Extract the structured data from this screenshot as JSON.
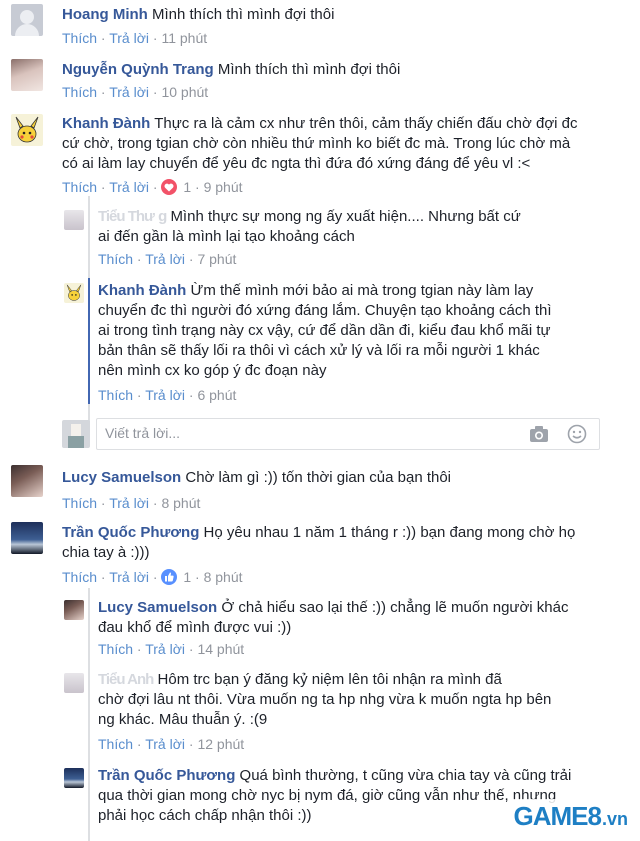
{
  "actions": {
    "like": "Thích",
    "reply": "Trả lời",
    "sep": "·"
  },
  "comments": [
    {
      "name": "Hoang Minh",
      "text": "Mình thích thì mình đợi thôi",
      "time": "11 phút"
    },
    {
      "name": "Nguyễn Quỳnh Trang",
      "text": "Mình thích thì mình đợi thôi",
      "time": "10 phút"
    },
    {
      "name": "Khanh Đành",
      "lines": [
        "Thực ra là cảm cx như trên thôi, cảm thấy chiến đấu chờ đợi đc",
        "cứ chờ, trong tgian chờ còn nhiều thứ mình ko biết đc mà. Trong lúc chờ mà",
        "có ai làm lay chuyển để yêu đc ngta thì đứa đó xứng đáng để yêu vl :<"
      ],
      "reactions": "1",
      "time": "9 phút"
    },
    {
      "name": "Tiểu Thư",
      "name_tail": "g",
      "lines": [
        "Mình thực sự mong ng ấy xuất hiện.... Nhưng bất cứ",
        "ai đến gần là mình lại tạo khoảng cách"
      ],
      "time": "7 phút"
    },
    {
      "name": "Khanh Đành",
      "lines": [
        "Ừm thế mình mới bảo ai mà trong tgian này làm lay",
        "chuyển đc thì người đó xứng đáng lắm. Chuyện tạo khoảng cách thì",
        "ai trong tình trạng này cx vậy, cứ để dần dần đi, kiểu đau khổ mãi tự",
        "bản thân sẽ thấy lối ra thôi vì cách xử lý và lối ra mỗi người 1 khác",
        "nên mình cx ko góp ý đc đoạn này"
      ],
      "time": "6 phút"
    },
    {
      "name": "Lucy Samuelson",
      "text": "Chờ làm gì :)) tốn thời gian của bạn thôi",
      "time": "8 phút"
    },
    {
      "name": "Trần Quốc Phương",
      "lines": [
        "Họ yêu nhau 1 năm 1 tháng r :)) bạn đang mong chờ họ",
        "chia tay à :)))"
      ],
      "reactions": "1",
      "time": "8 phút"
    },
    {
      "name": "Lucy Samuelson",
      "lines": [
        "Ở chả hiểu sao lại thế :)) chẳng lẽ muốn người khác",
        "đau khổ để mình được vui :))"
      ],
      "time": "14 phút"
    },
    {
      "name": "Tiểu Anh",
      "lines": [
        "Hôm trc bạn ý đăng kỷ niệm lên tôi nhận ra mình đã",
        "chờ đợi lâu nt thôi. Vừa muốn ng ta hp nhg vừa k muốn ngta hp bên",
        "ng khác. Mâu thuẫn ý. :(9"
      ],
      "time": "12 phút"
    },
    {
      "name": "Trần Quốc Phương",
      "lines": [
        "Quá bình thường, t cũng vừa chia tay và cũng trải",
        "qua thời gian mong chờ nyc bị nym đá, giờ cũng vẫn như thế, nhưng",
        "phải học cách chấp nhận thôi :))"
      ]
    }
  ],
  "reply_box": {
    "placeholder": "Viết trả lời..."
  },
  "watermark": {
    "brand": "GAME8",
    "suffix": ".vn"
  },
  "colors": {
    "link": "#365899",
    "meta": "#90949c",
    "heart": "#f25268",
    "like": "#5890ff"
  },
  "icons": [
    "camera-icon",
    "emoji-icon",
    "heart-reaction-icon",
    "like-reaction-icon"
  ]
}
